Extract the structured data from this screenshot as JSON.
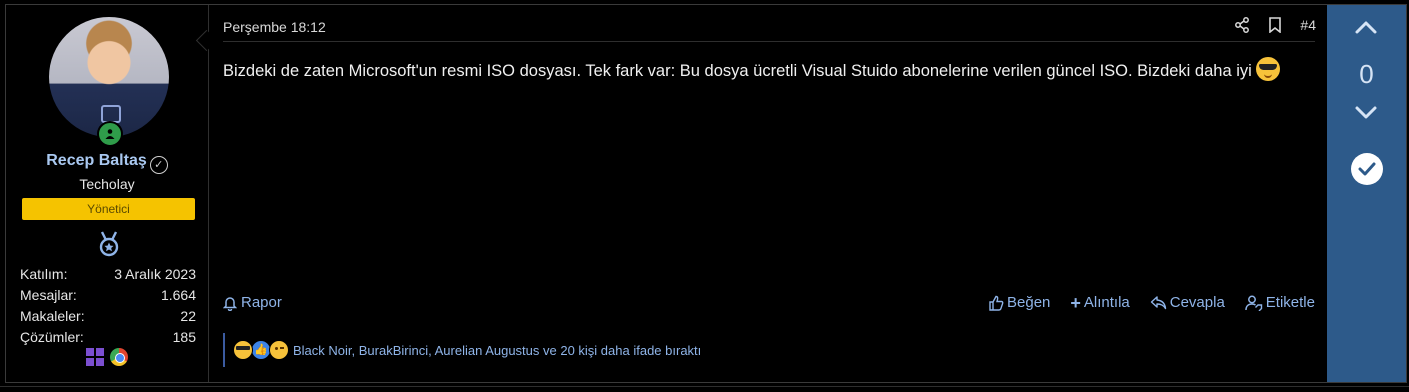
{
  "user": {
    "name": "Recep Baltaş",
    "title": "Techolay",
    "role": "Yönetici",
    "stats": [
      {
        "label": "Katılım:",
        "value": "3 Aralık 2023"
      },
      {
        "label": "Mesajlar:",
        "value": "1.664"
      },
      {
        "label": "Makaleler:",
        "value": "22"
      },
      {
        "label": "Çözümler:",
        "value": "185"
      }
    ]
  },
  "post": {
    "date": "Perşembe 18:12",
    "number": "#4",
    "content": "Bizdeki de zaten Microsoft'un resmi ISO dosyası. Tek fark var: Bu dosya ücretli Visual Stuido abonelerine verilen güncel ISO. Bizdeki daha iyi",
    "actions": {
      "report": "Rapor",
      "like": "Beğen",
      "quote": "Alıntıla",
      "reply": "Cevapla",
      "tag": "Etiketle"
    },
    "reactions_text": "Black Noir, BurakBirinci, Aurelian Augustus ve 20 kişi daha ifade bıraktı"
  },
  "vote": {
    "count": "0"
  },
  "colors": {
    "accent": "#8fb4e8",
    "vote_bg": "#2d5a8a",
    "role_banner": "#f5c300",
    "online": "#2f9c4a"
  }
}
